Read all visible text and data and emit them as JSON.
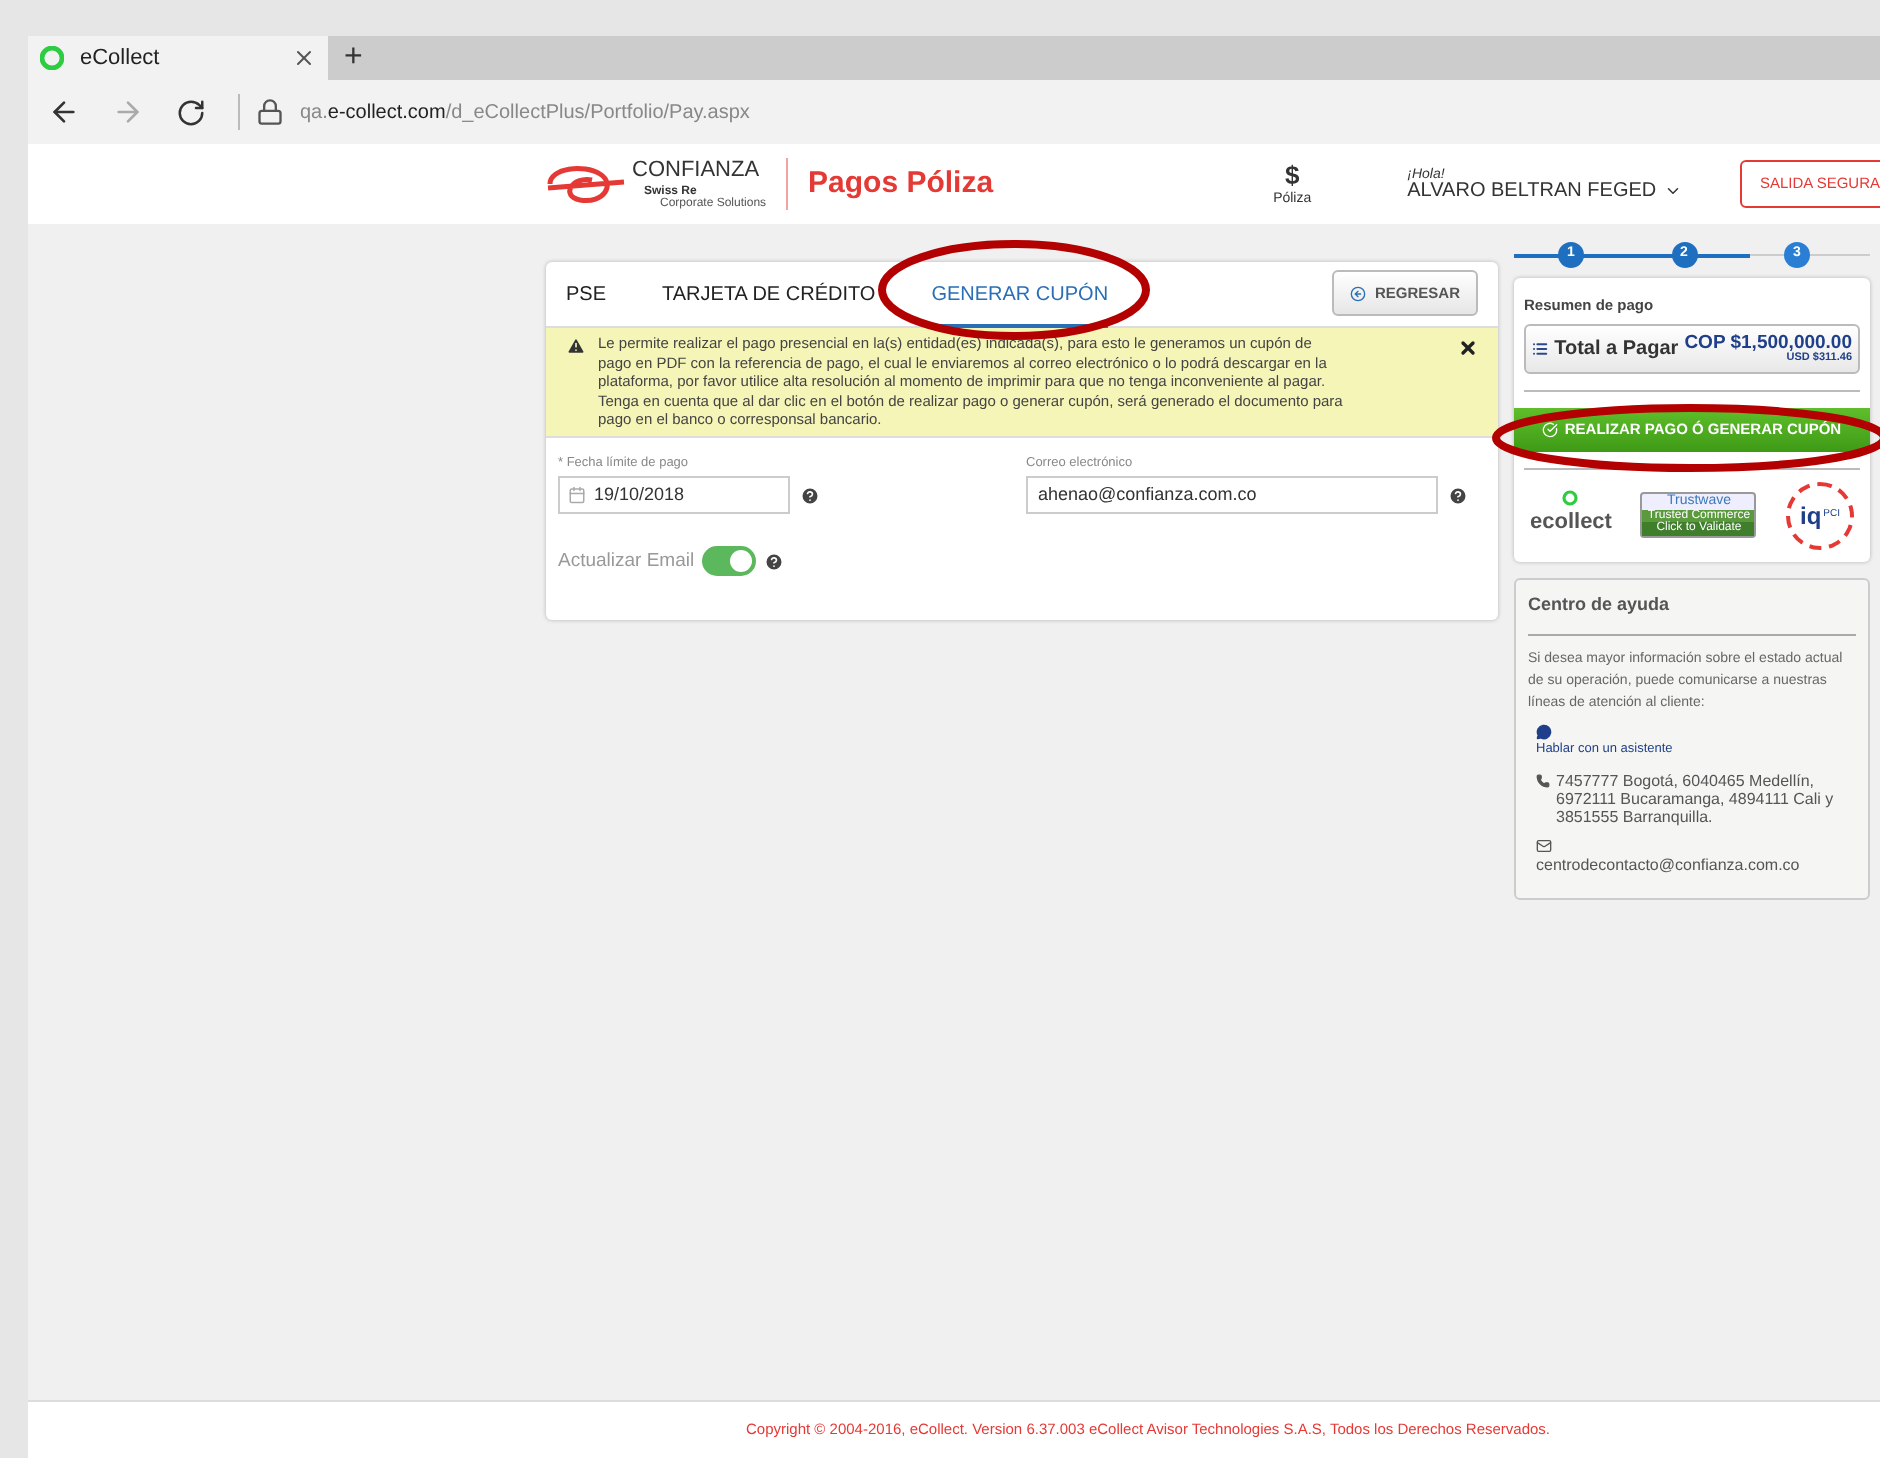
{
  "browser": {
    "tab_title": "eCollect",
    "new_tab": "+",
    "url_prefix": "qa.",
    "url_domain": "e-collect.com",
    "url_path": "/d_eCollectPlus/Portfolio/Pay.aspx"
  },
  "header": {
    "brand": "CONFIANZA",
    "brand_sub": "Swiss Re",
    "brand_sub2": "Corporate Solutions",
    "page_title": "Pagos Póliza",
    "nav_symbol": "$",
    "nav_label": "Póliza",
    "greeting": "¡Hola!",
    "user": "ALVARO BELTRAN FEGED",
    "logout": "SALIDA SEGURA"
  },
  "tabs": [
    {
      "label": "PSE",
      "selected": false
    },
    {
      "label": "TARJETA DE CRÉDITO",
      "selected": false
    },
    {
      "label": "GENERAR CUPÓN",
      "selected": true
    }
  ],
  "back_button": "REGRESAR",
  "alert": "Le permite realizar el pago presencial en la(s) entidad(es) indicada(s), para esto le generamos un cupón de pago en PDF con la referencia de pago, el cual le enviaremos al correo electrónico o lo podrá descargar en la plataforma, por favor utilice alta resolución al momento de imprimir para que no tenga inconveniente al pagar. Tenga en cuenta que al dar clic en el botón de realizar pago o generar cupón, será generado el documento para pago en el banco o corresponsal bancario.",
  "date_field": {
    "label": "* Fecha límite de pago",
    "value": "19/10/2018"
  },
  "email_field": {
    "label": "Correo electrónico",
    "value": "ahenao@confianza.com.co"
  },
  "update_email": {
    "label": "Actualizar Email",
    "on": true
  },
  "steps": [
    {
      "label": "1",
      "done": true
    },
    {
      "label": "2",
      "done": true
    },
    {
      "label": "3",
      "done": false
    }
  ],
  "summary": {
    "title": "Resumen de pago",
    "total_label": "Total a Pagar",
    "total": "COP $1,500,000.00",
    "total_usd": "USD $311.46",
    "pay_button": "REALIZAR PAGO Ó GENERAR CUPÓN",
    "logos": [
      "ecollect",
      "Trustwave",
      "Trusted Commerce",
      "Click to Validate",
      "iq",
      "PCI"
    ]
  },
  "help": {
    "title": "Centro de ayuda",
    "intro": "Si desea mayor información sobre el estado actual de su operación, puede comunicarse a nuestras líneas de atención al cliente:",
    "chat": "Hablar con un asistente",
    "phones": "7457777 Bogotá, 6040465 Medellín, 6972111 Bucaramanga, 4894111 Cali y 3851555 Barranquilla.",
    "email": "centrodecontacto@confianza.com.co"
  },
  "footer": "Copyright © 2004-2016, eCollect. Version 6.37.003 eCollect Avisor Technologies S.A.S, Todos los Derechos Reservados."
}
